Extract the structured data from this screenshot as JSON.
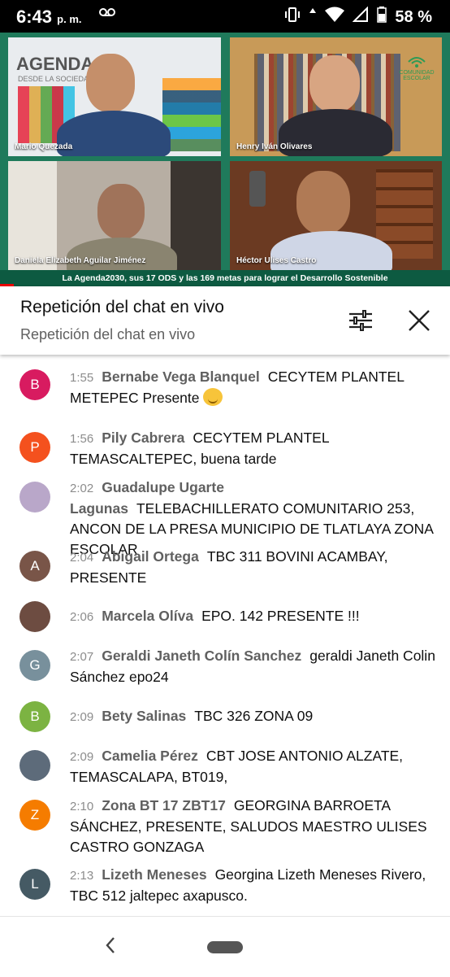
{
  "status_bar": {
    "time": "6:43",
    "ampm": "p. m.",
    "battery_percent": "58 %",
    "icons": [
      "voicemail-icon",
      "vibrate-icon",
      "data-arrows-icon",
      "wifi-icon",
      "signal-icon",
      "battery-icon"
    ]
  },
  "video": {
    "participants": [
      {
        "name": "Mario Quezada"
      },
      {
        "name": "Henry Iván Olivares"
      },
      {
        "name": "Daniela Elizabeth Aguilar Jiménez"
      },
      {
        "name": "Héctor Ulises Castro"
      }
    ],
    "background_text": {
      "agenda": "AGENDA 20",
      "agenda_sub": "DESDE LA SOCIEDAD",
      "logo": "COMUNIDAD ESCOLAR"
    },
    "caption": "La Agenda2030, sus 17 ODS y las 169 metas para lograr el Desarrollo Sostenible",
    "progress_fraction": 0.03
  },
  "chat_header": {
    "title": "Repetición del chat en vivo",
    "subtitle": "Repetición del chat en vivo",
    "icons": [
      "filter-icon",
      "close-icon"
    ]
  },
  "messages": [
    {
      "time": "1:55",
      "author": "Bernabe Vega Blanquel",
      "text": "CECYTEM PLANTEL METEPEC Presente",
      "initial": "B",
      "avatar_color": "#d81b60",
      "has_emoji": true
    },
    {
      "time": "1:56",
      "author": "Pily Cabrera",
      "text": "CECYTEM PLANTEL TEMASCALTEPEC, buena tarde",
      "initial": "P",
      "avatar_color": "#f4511e"
    },
    {
      "time": "2:02",
      "author": "Guadalupe Ugarte Lagunas",
      "text": "TELEBACHILLERATO COMUNITARIO 253, ANCON DE LA PRESA MUNICIPIO DE TLATLAYA ZONA ESCOLAR",
      "initial": "",
      "avatar_color": "#b9a7c9"
    },
    {
      "time": "2:04",
      "author": "Abigail Ortega",
      "text": "TBC 311 BOVINI ACAMBAY, PRESENTE",
      "initial": "A",
      "avatar_color": "#795548"
    },
    {
      "time": "2:06",
      "author": "Marcela Olíva",
      "text": "EPO. 142 PRESENTE !!!",
      "initial": "",
      "avatar_color": "#6d4c41"
    },
    {
      "time": "2:07",
      "author": "Geraldi Janeth Colín Sanchez",
      "text": "geraldi Janeth Colin Sánchez epo24",
      "initial": "G",
      "avatar_color": "#78909c"
    },
    {
      "time": "2:09",
      "author": "Bety Salinas",
      "text": "TBC 326 ZONA 09",
      "initial": "B",
      "avatar_color": "#7cb342"
    },
    {
      "time": "2:09",
      "author": "Camelia Pérez",
      "text": "CBT JOSE ANTONIO ALZATE, TEMASCALAPA, BT019,",
      "initial": "",
      "avatar_color": "#5d6b7a"
    },
    {
      "time": "2:10",
      "author": "Zona BT 17 ZBT17",
      "text": "GEORGINA BARROETA SÁNCHEZ, PRESENTE, SALUDOS MAESTRO ULISES CASTRO GONZAGA",
      "initial": "Z",
      "avatar_color": "#f57c00"
    },
    {
      "time": "2:13",
      "author": "Lizeth Meneses",
      "text": "Georgina Lizeth Meneses Rivero, TBC 512 jaltepec axapusco.",
      "initial": "L",
      "avatar_color": "#455a64"
    }
  ],
  "navbar": {
    "icons": [
      "back-icon",
      "home-pill-icon"
    ]
  }
}
